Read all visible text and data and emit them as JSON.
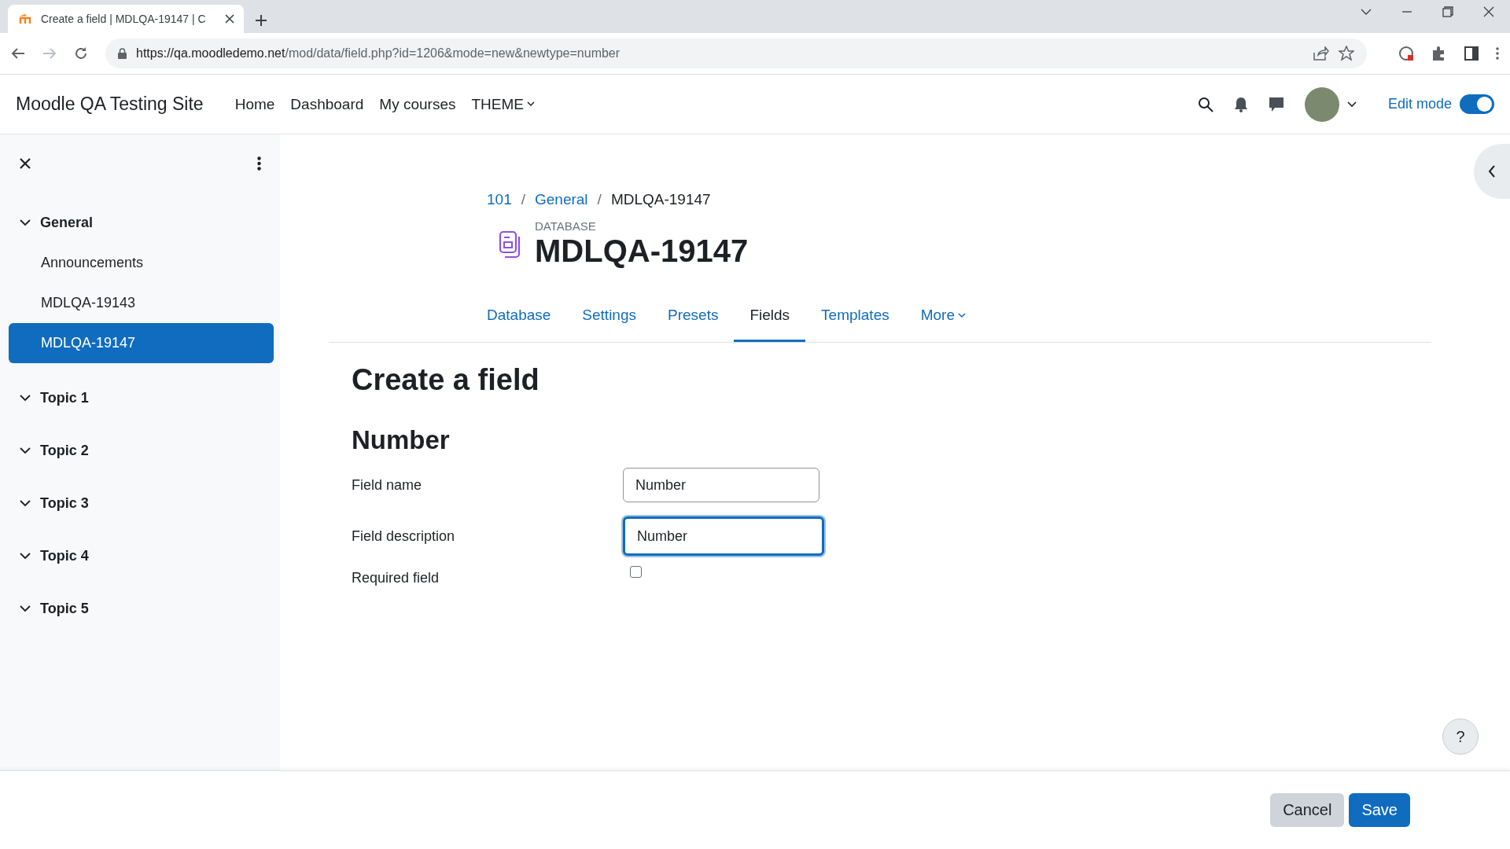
{
  "browser": {
    "tab_title": "Create a field | MDLQA-19147 | C",
    "url_host": "https://qa.moodledemo.net",
    "url_path": "/mod/data/field.php?id=1206&mode=new&newtype=number"
  },
  "navbar": {
    "site_name": "Moodle QA Testing Site",
    "links": [
      {
        "label": "Home",
        "kind": "link"
      },
      {
        "label": "Dashboard",
        "kind": "link"
      },
      {
        "label": "My courses",
        "kind": "link"
      },
      {
        "label": "THEME",
        "kind": "dropdown"
      }
    ],
    "edit_mode": {
      "label": "Edit mode",
      "on": true
    }
  },
  "sidebar": {
    "sections": [
      {
        "label": "General",
        "expanded": true,
        "children": [
          {
            "label": "Announcements",
            "selected": false
          },
          {
            "label": "MDLQA-19143",
            "selected": false
          },
          {
            "label": "MDLQA-19147",
            "selected": true
          }
        ]
      },
      {
        "label": "Topic 1",
        "expanded": true
      },
      {
        "label": "Topic 2",
        "expanded": true
      },
      {
        "label": "Topic 3",
        "expanded": true
      },
      {
        "label": "Topic 4",
        "expanded": true
      },
      {
        "label": "Topic 5",
        "expanded": true
      }
    ]
  },
  "breadcrumb": [
    {
      "label": "101",
      "kind": "link"
    },
    {
      "label": "/",
      "kind": "separator"
    },
    {
      "label": "General",
      "kind": "link"
    },
    {
      "label": "/",
      "kind": "separator"
    },
    {
      "label": "MDLQA-19147",
      "kind": "current"
    }
  ],
  "activity": {
    "type_label": "DATABASE",
    "title": "MDLQA-19147"
  },
  "tabs": [
    {
      "label": "Database",
      "selected": false,
      "kind": "tab"
    },
    {
      "label": "Settings",
      "selected": false,
      "kind": "tab"
    },
    {
      "label": "Presets",
      "selected": false,
      "kind": "tab"
    },
    {
      "label": "Fields",
      "selected": true,
      "kind": "tab"
    },
    {
      "label": "Templates",
      "selected": false,
      "kind": "tab"
    },
    {
      "label": "More",
      "selected": false,
      "kind": "dropdown"
    }
  ],
  "page_title": "Create a field",
  "section_title": "Number",
  "form": [
    {
      "kind": "text",
      "label": "Field name",
      "value": "Number",
      "focused": false
    },
    {
      "kind": "text",
      "label": "Field description",
      "value": "Number",
      "focused": true
    },
    {
      "kind": "checkbox",
      "label": "Required field",
      "checked": false
    }
  ],
  "help": {
    "label": "?"
  },
  "footer_buttons": [
    {
      "label": "Cancel",
      "kind": "secondary"
    },
    {
      "label": "Save",
      "kind": "primary"
    }
  ]
}
